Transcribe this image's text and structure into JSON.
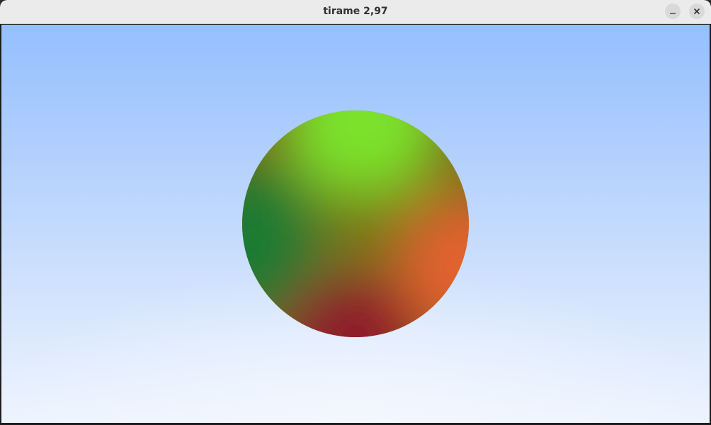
{
  "window": {
    "title": "tirame 2,97"
  },
  "titlebar_buttons": {
    "minimize_icon": "minimize-icon",
    "close_icon": "close-icon"
  },
  "scene": {
    "sky_top_color": "#94bffe",
    "sky_bottom_color": "#eef4fe",
    "sphere_colors": {
      "top": "#7be22a",
      "right": "#e3622f",
      "bottom": "#8f1f2c",
      "left": "#1e7a32",
      "center": "#7a7a14"
    }
  }
}
